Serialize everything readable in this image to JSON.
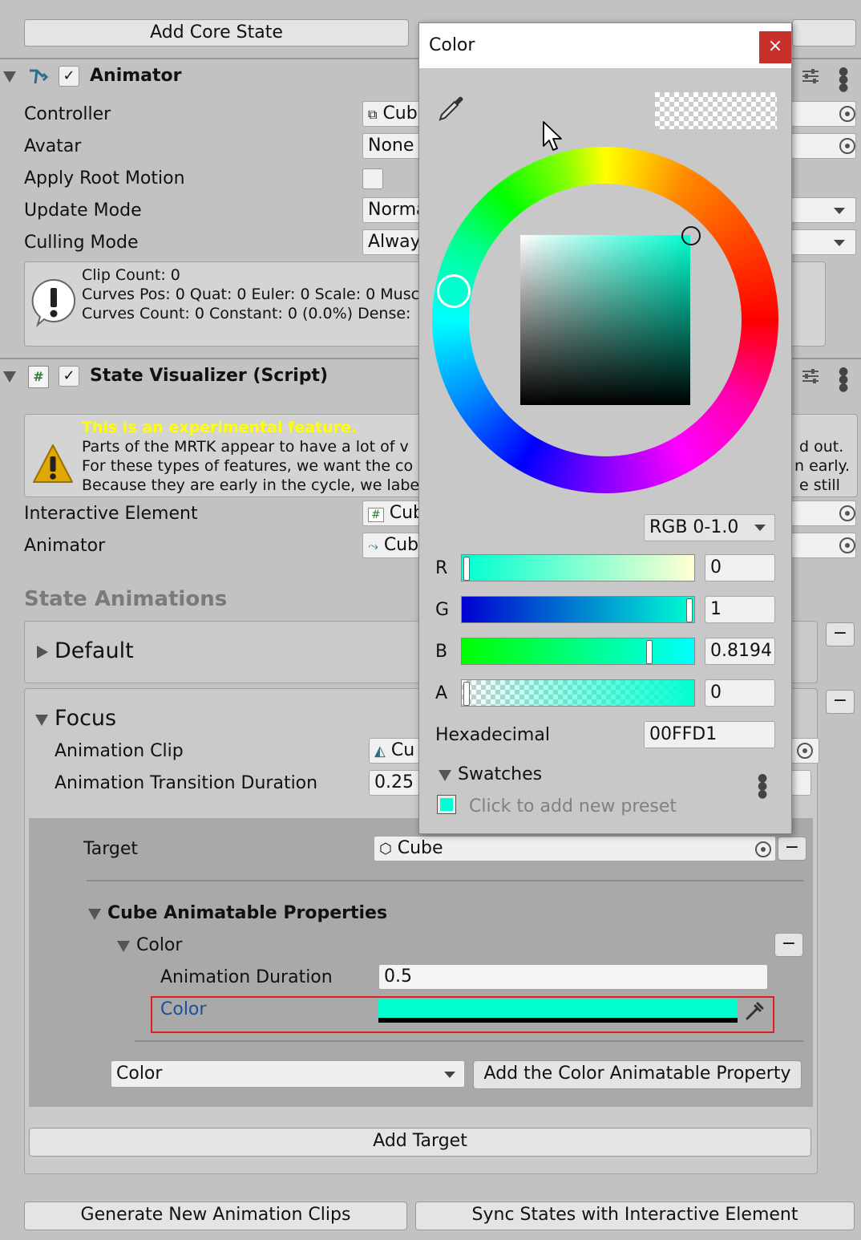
{
  "top_buttons": {
    "add_core_state": "Add Core State"
  },
  "animator": {
    "title": "Animator",
    "controller_label": "Controller",
    "controller_value": "Cub",
    "avatar_label": "Avatar",
    "avatar_value": "None",
    "apply_root_motion_label": "Apply Root Motion",
    "update_mode_label": "Update Mode",
    "update_mode_value": "Norma",
    "culling_mode_label": "Culling Mode",
    "culling_mode_value": "Alway",
    "info_lines": [
      "Clip Count: 0",
      "Curves Pos: 0 Quat: 0 Euler: 0 Scale: 0 Musc",
      "Curves Count: 0 Constant: 0 (0.0%) Dense:"
    ]
  },
  "state_visualizer": {
    "title": "State Visualizer (Script)",
    "warning_title": "This is an experimental feature.",
    "warning_lines": [
      "Parts of the MRTK appear to have a lot of v",
      "For these types of features, we want the co",
      "Because they are early in the cycle, we labe"
    ],
    "warning_right": [
      "d out.",
      "n early.",
      "e still"
    ],
    "interactive_element_label": "Interactive Element",
    "interactive_element_value": "Cub",
    "animator_label": "Animator",
    "animator_value": "Cub",
    "state_animations_label": "State Animations",
    "default_label": "Default",
    "focus_label": "Focus",
    "animation_clip_label": "Animation Clip",
    "animation_clip_value": "Cu",
    "transition_duration_label": "Animation Transition Duration",
    "transition_duration_value": "0.25",
    "target_label": "Target",
    "target_value": "Cube",
    "cube_props_label": "Cube Animatable Properties",
    "color_group_label": "Color",
    "animation_duration_label": "Animation Duration",
    "animation_duration_value": "0.5",
    "color_field_label": "Color",
    "color_swatch": "#00ffd1",
    "property_dropdown_value": "Color",
    "add_property_button": "Add the Color Animatable Property",
    "add_target_button": "Add Target",
    "minus": "−"
  },
  "bottom_buttons": {
    "generate": "Generate New Animation Clips",
    "sync": "Sync States with Interactive Element"
  },
  "color_picker": {
    "title": "Color",
    "close": "×",
    "mode": "RGB 0-1.0",
    "r_label": "R",
    "r_value": "0",
    "g_label": "G",
    "g_value": "1",
    "b_label": "B",
    "b_value": "0.8194",
    "a_label": "A",
    "a_value": "0",
    "hex_label": "Hexadecimal",
    "hex_value": "00FFD1",
    "swatches_label": "Swatches",
    "add_preset": "Click to add new preset",
    "r_level": 0,
    "g_level": 1,
    "b_level": 0.8194,
    "a_level": 0,
    "icons": [
      "eyedropper-icon",
      "close-icon",
      "kebab-menu-icon",
      "dropdown-arrow-icon"
    ]
  },
  "colors": {
    "highlight_border": "#e02020",
    "warning_text": "#ffff00",
    "link_label": "#1a4f9c"
  }
}
